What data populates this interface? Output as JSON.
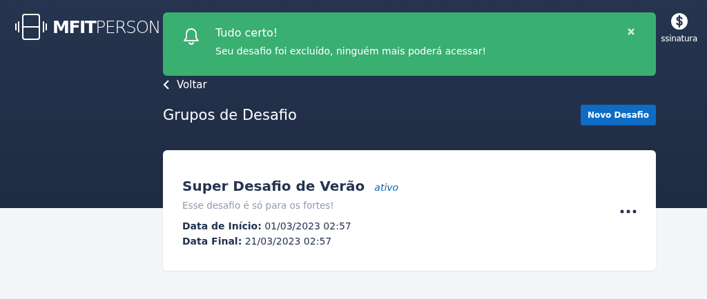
{
  "header": {
    "brand_bold": "MFIT",
    "brand_light": "PERSON",
    "account_link": "ssinatura"
  },
  "toast": {
    "title": "Tudo certo!",
    "message": "Seu desafio foi excluído, ninguém mais poderá acessar!"
  },
  "back_link": "Voltar",
  "page_title": "Grupos de Desafio",
  "new_button": "Novo Desafio",
  "challenges": [
    {
      "name": "Super Desafio de Verão",
      "status": "ativo",
      "description": "Esse desafio é só para os fortes!",
      "start_label": "Data de Início:",
      "start": "01/03/2023 02:57",
      "end_label": "Data Final:",
      "end": "21/03/2023 02:57"
    }
  ]
}
